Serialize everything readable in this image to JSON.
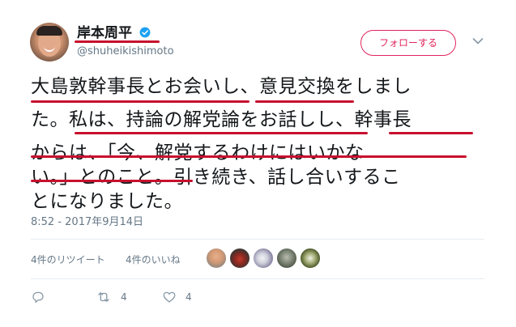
{
  "user": {
    "display_name": "岸本周平",
    "handle": "@shuheikishimoto",
    "verified_icon": "verified-badge-icon"
  },
  "follow_button_label": "フォローする",
  "tweet": {
    "lines": [
      "大島敦幹事長とお会いし、意見交換をしまし",
      "た。私は、持論の解党論をお話しし、幹事長",
      "からは、「今、解党するわけにはいかな",
      "い。」とのこと。引き続き、話し合いするこ",
      "とになりました。"
    ],
    "timestamp": "8:52 - 2017年9月14日"
  },
  "stats": {
    "retweets_label": "4件のリツイート",
    "likes_label": "4件のいいね"
  },
  "actions": {
    "reply_icon": "reply-icon",
    "retweet_icon": "retweet-icon",
    "retweet_count": "4",
    "like_icon": "heart-icon",
    "like_count": "4"
  },
  "colors": {
    "accent": "#e0245e",
    "verified": "#1da1f2",
    "underline": "#c8102e",
    "secondary_text": "#657786"
  }
}
